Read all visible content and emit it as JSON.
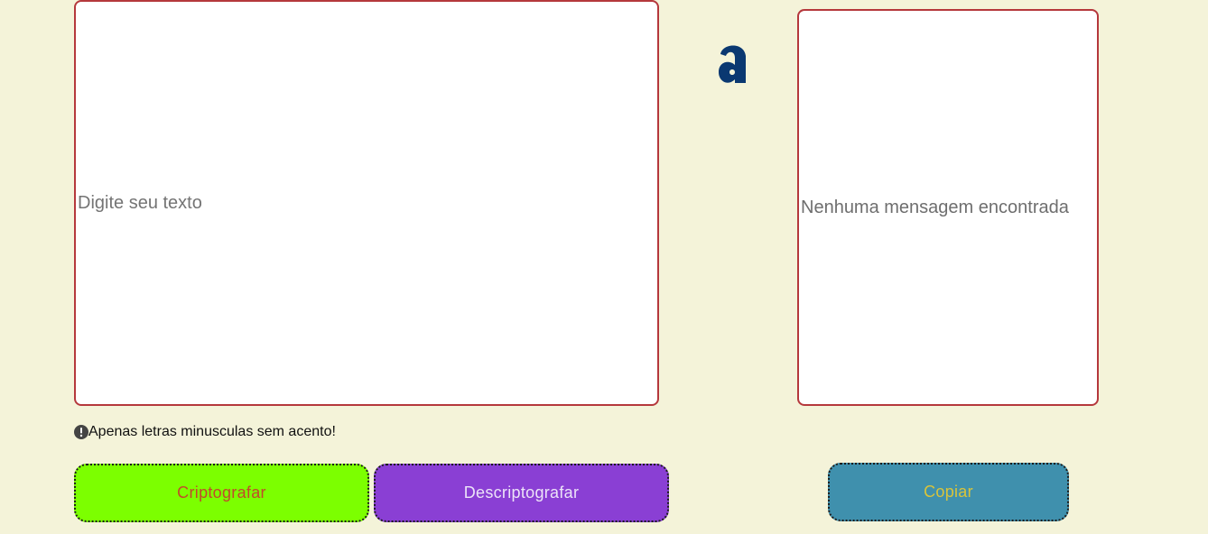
{
  "input": {
    "placeholder": "Digite seu texto"
  },
  "logo": {
    "icon": "alura-a-logo-icon",
    "color": "#0a3871"
  },
  "output": {
    "empty_message": "Nenhuma mensagem encontrada"
  },
  "warning": {
    "icon": "exclamation-circle-icon",
    "text": "Apenas letras minusculas sem acento!"
  },
  "buttons": {
    "encrypt_label": "Criptografar",
    "decrypt_label": "Descriptografar",
    "copy_label": "Copiar"
  },
  "colors": {
    "background": "#f4f3d9",
    "border": "#b5383c",
    "encrypt_bg": "#7cff00",
    "decrypt_bg": "#8a3fd4",
    "copy_bg": "#3f90ad"
  }
}
